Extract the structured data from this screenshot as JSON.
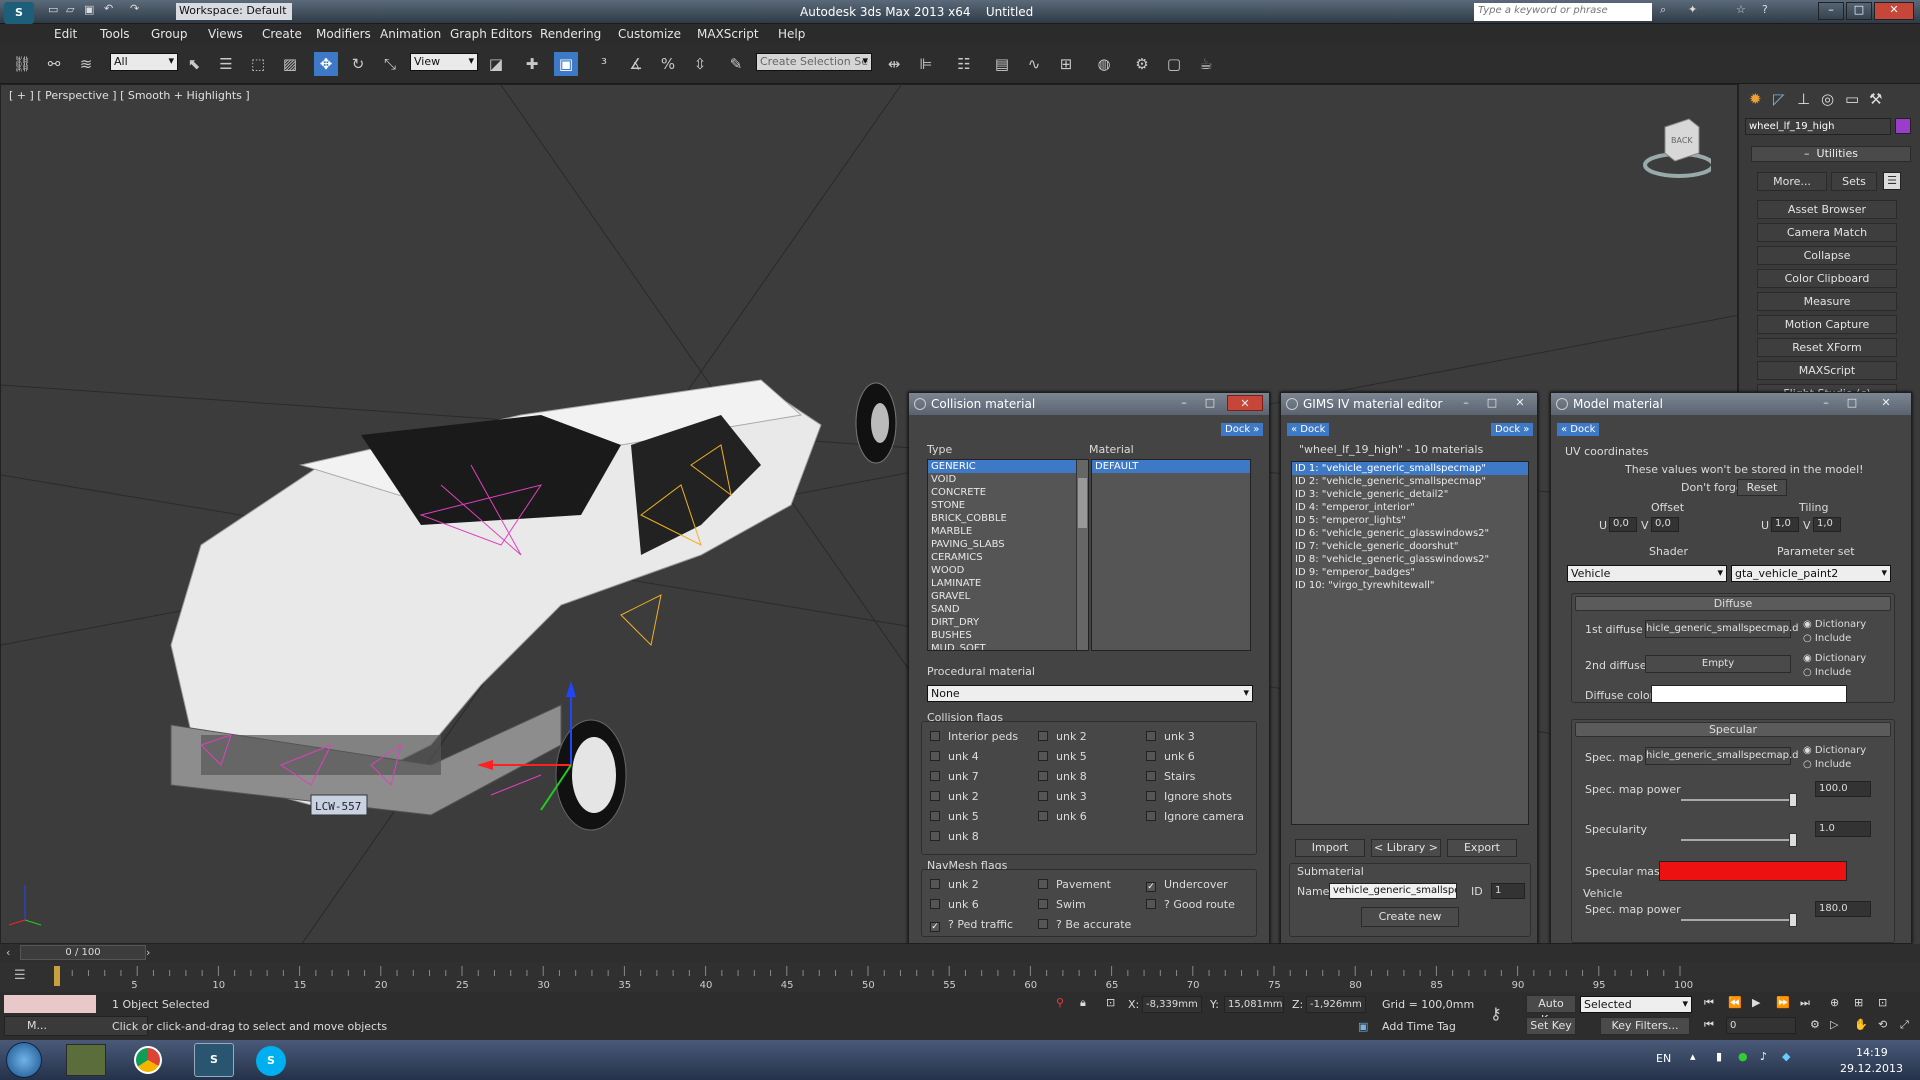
{
  "app": {
    "workspace": "Workspace: Default",
    "title": "Autodesk 3ds Max  2013 x64",
    "doc": "Untitled",
    "search_placeholder": "Type a keyword or phrase"
  },
  "menu": [
    "Edit",
    "Tools",
    "Group",
    "Views",
    "Create",
    "Modifiers",
    "Animation",
    "Graph Editors",
    "Rendering",
    "Customize",
    "MAXScript",
    "Help"
  ],
  "toolbar": {
    "filter": "All",
    "refcoord": "View",
    "selset": "Create Selection Se"
  },
  "viewport": {
    "label": "[ + ] [ Perspective ] [ Smooth + Highlights ]",
    "plate": "LCW-557",
    "view_cube": "BACK"
  },
  "command_panel": {
    "object_name": "wheel_lf_19_high",
    "rollout": "Utilities",
    "more": "More...",
    "sets": "Sets",
    "utilities": [
      "Asset Browser",
      "Camera Match",
      "Collapse",
      "Color Clipboard",
      "Measure",
      "Motion Capture",
      "Reset XForm",
      "MAXScript",
      "Flight Studio (c)"
    ]
  },
  "collision": {
    "title": "Collision material",
    "dock": "Dock »",
    "type_label": "Type",
    "material_label": "Material",
    "types": [
      "GENERIC",
      "VOID",
      "CONCRETE",
      "STONE",
      "BRICK_COBBLE",
      "MARBLE",
      "PAVING_SLABS",
      "CERAMICS",
      "WOOD",
      "LAMINATE",
      "GRAVEL",
      "SAND",
      "DIRT_DRY",
      "BUSHES",
      "MUD_SOFT"
    ],
    "materials": [
      "DEFAULT"
    ],
    "procedural_label": "Procedural material",
    "procedural": "None",
    "flags_label": "Collision flags",
    "flags": [
      {
        "label": "Interior peds",
        "checked": false
      },
      {
        "label": "unk 2",
        "checked": false
      },
      {
        "label": "unk 3",
        "checked": false
      },
      {
        "label": "unk 4",
        "checked": false
      },
      {
        "label": "unk 5",
        "checked": false
      },
      {
        "label": "unk 6",
        "checked": false
      },
      {
        "label": "unk 7",
        "checked": false
      },
      {
        "label": "unk 8",
        "checked": false
      },
      {
        "label": "Stairs",
        "checked": false
      },
      {
        "label": "unk 2",
        "checked": false
      },
      {
        "label": "unk 3",
        "checked": false
      },
      {
        "label": "Ignore shots",
        "checked": false
      },
      {
        "label": "unk 5",
        "checked": false
      },
      {
        "label": "unk 6",
        "checked": false
      },
      {
        "label": "Ignore camera",
        "checked": false
      },
      {
        "label": "unk 8",
        "checked": false
      }
    ],
    "nav_label": "NavMesh flags",
    "nav": [
      {
        "label": "unk 2",
        "checked": false
      },
      {
        "label": "Pavement",
        "checked": false
      },
      {
        "label": "Undercover",
        "checked": true
      },
      {
        "label": "unk 6",
        "checked": false
      },
      {
        "label": "Swim",
        "checked": false
      },
      {
        "label": "? Good route",
        "checked": false
      },
      {
        "label": "? Ped traffic",
        "checked": true
      },
      {
        "label": "? Be accurate",
        "checked": false
      }
    ]
  },
  "gims": {
    "title": "GIMS IV material editor",
    "dock_left": "« Dock",
    "dock_right": "Dock »",
    "header": "\"wheel_lf_19_high\" - 10 materials",
    "materials": [
      "ID 1: \"vehicle_generic_smallspecmap\"",
      "ID 2: \"vehicle_generic_smallspecmap\"",
      "ID 3: \"vehicle_generic_detail2\"",
      "ID 4: \"emperor_interior\"",
      "ID 5: \"emperor_lights\"",
      "ID 6: \"vehicle_generic_glasswindows2\"",
      "ID 7: \"vehicle_generic_doorshut\"",
      "ID 8: \"vehicle_generic_glasswindows2\"",
      "ID 9: \"emperor_badges\"",
      "ID 10: \"virgo_tyrewhitewall\""
    ],
    "import": "Import",
    "library": "< Library >",
    "export": "Export",
    "sub_label": "Submaterial",
    "name_label": "Name",
    "name_value": "vehicle_generic_smallspe",
    "id_label": "ID",
    "id_value": "1",
    "create": "Create new"
  },
  "model": {
    "title": "Model material",
    "dock": "« Dock",
    "uv_label": "UV coordinates",
    "note1": "These values won't be stored in the model!",
    "note2": "Don't forget to:",
    "reset": "Reset",
    "offset_label": "Offset",
    "tiling_label": "Tiling",
    "u": "U",
    "v": "V",
    "offset_u": "0,0",
    "offset_v": "0,0",
    "tiling_u": "1,0",
    "tiling_v": "1,0",
    "shader_label": "Shader",
    "param_label": "Parameter set",
    "shader": "Vehicle",
    "param": "gta_vehicle_paint2",
    "diffuse_label": "Diffuse",
    "d1_label": "1st diffuse",
    "d1_value": "hicle_generic_smallspecmap.d",
    "d2_label": "2nd diffuse",
    "d2_value": "Empty",
    "dict": "Dictionary",
    "incl": "Include",
    "dcolor_label": "Diffuse color",
    "diffuse_color": "#ffffff",
    "specular_label": "Specular",
    "spec_map_label": "Spec. map",
    "spec_map_value": "hicle_generic_smallspecmap.d",
    "spec_power_label": "Spec. map power",
    "spec_power": "100.0",
    "specularity_label": "Specularity",
    "specularity": "1.0",
    "spec_mask_label": "Specular mask",
    "spec_mask_color": "#ee1111",
    "vehicle_label": "Vehicle",
    "veh_power_label": "Spec. map power",
    "veh_power": "180.0"
  },
  "time": {
    "frame": "0 / 100",
    "ticks": [
      "5",
      "10",
      "15",
      "20",
      "25",
      "30",
      "35",
      "40",
      "45",
      "50",
      "55",
      "60",
      "65",
      "70",
      "75",
      "80",
      "85",
      "90",
      "95",
      "100"
    ]
  },
  "status": {
    "tab": "M...",
    "selected": "1 Object Selected",
    "prompt": "Click or click-and-drag to select and move objects",
    "x": "-8,339mm",
    "y": "15,081mm",
    "z": "-1,926mm",
    "grid": "Grid = 100,0mm",
    "addtime": "Add Time Tag",
    "autokey": "Auto Key",
    "setkey": "Set Key",
    "selected_mode": "Selected",
    "keyfilters": "Key Filters...",
    "frame_num": "0",
    "x_label": "X:",
    "y_label": "Y:",
    "z_label": "Z:"
  },
  "taskbar": {
    "lang": "EN",
    "time": "14:19",
    "date": "29.12.2013"
  }
}
